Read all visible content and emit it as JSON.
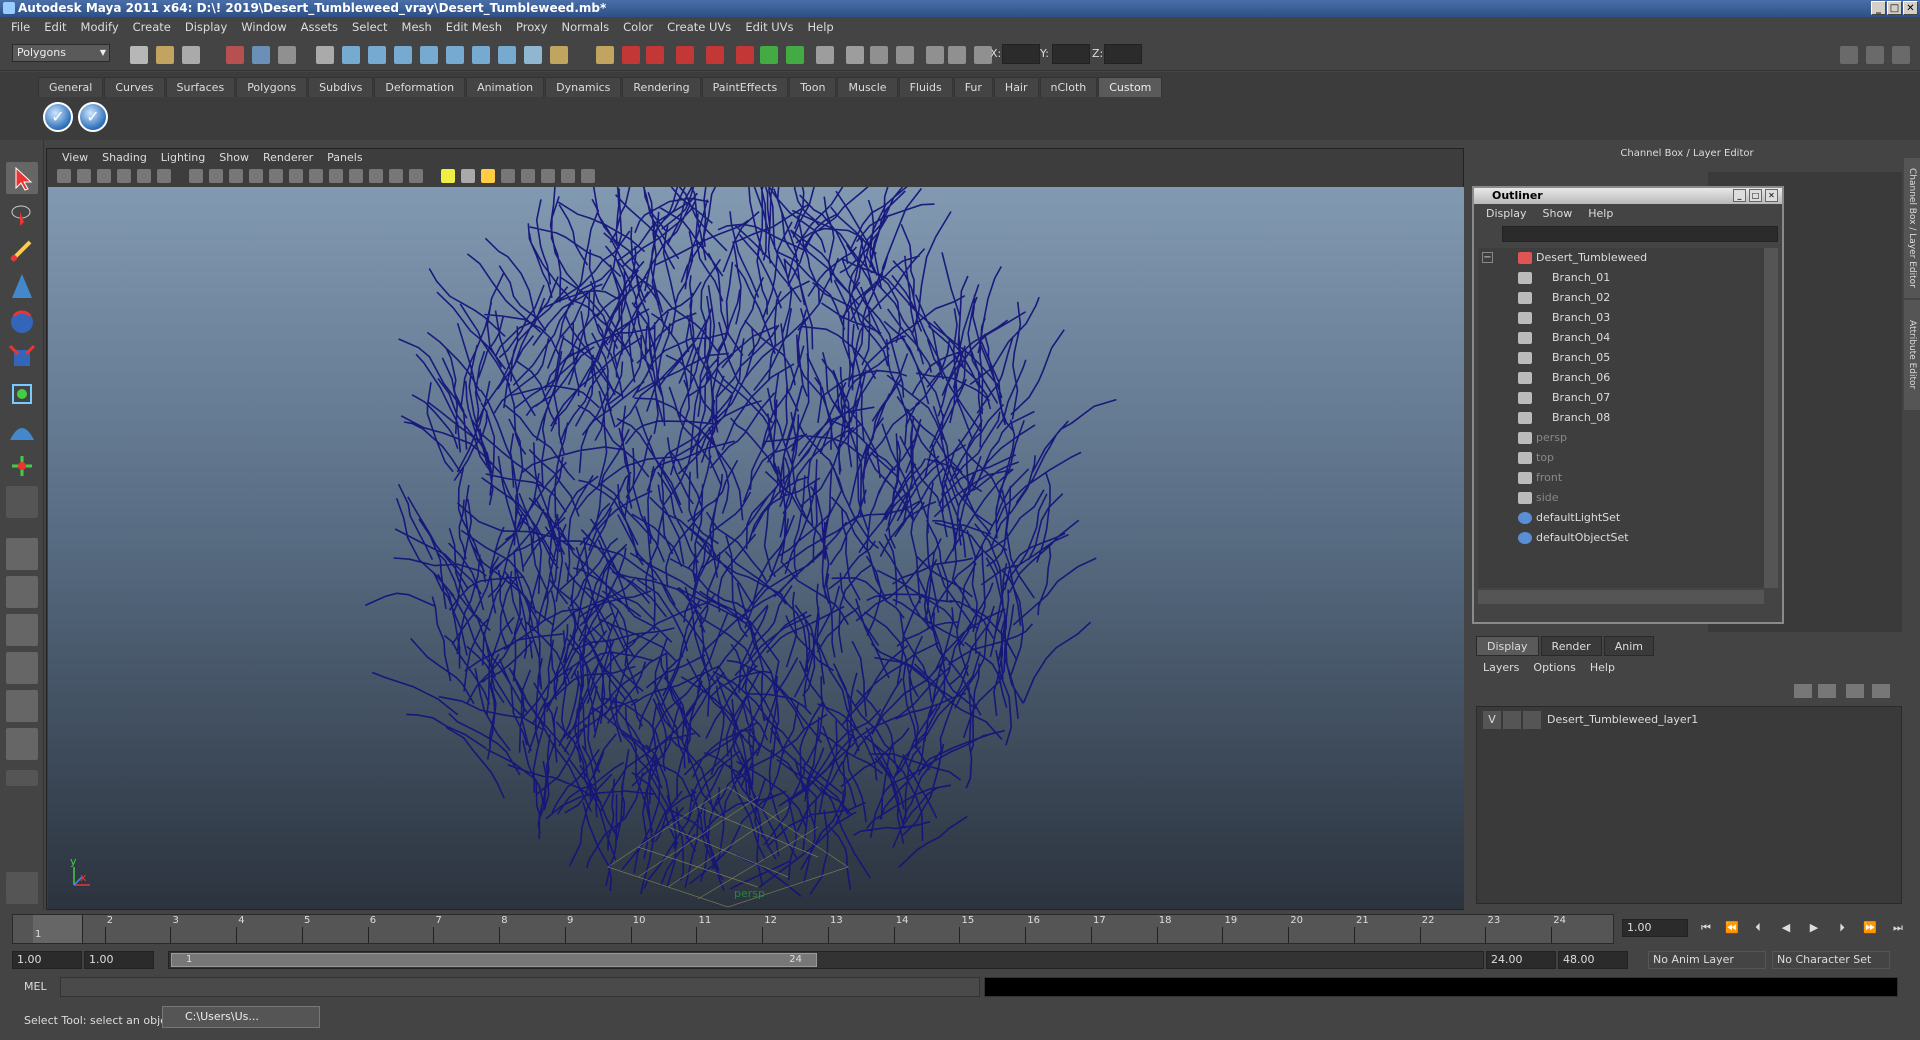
{
  "titlebar": {
    "title": "Autodesk Maya 2011 x64: D:\\! 2019\\Desert_Tumbleweed_vray\\Desert_Tumbleweed.mb*"
  },
  "menubar": [
    "File",
    "Edit",
    "Modify",
    "Create",
    "Display",
    "Window",
    "Assets",
    "Select",
    "Mesh",
    "Edit Mesh",
    "Proxy",
    "Normals",
    "Color",
    "Create UVs",
    "Edit UVs",
    "Help"
  ],
  "statusline": {
    "mode": "Polygons",
    "x_label": "X:",
    "y_label": "Y:",
    "z_label": "Z:"
  },
  "shelf": {
    "tabs": [
      "General",
      "Curves",
      "Surfaces",
      "Polygons",
      "Subdivs",
      "Deformation",
      "Animation",
      "Dynamics",
      "Rendering",
      "PaintEffects",
      "Toon",
      "Muscle",
      "Fluids",
      "Fur",
      "Hair",
      "nCloth",
      "Custom"
    ],
    "active": "Custom"
  },
  "viewport": {
    "menu": [
      "View",
      "Shading",
      "Lighting",
      "Show",
      "Renderer",
      "Panels"
    ],
    "camera_label": "persp",
    "axis_y": "y",
    "axis_x": "x"
  },
  "rightpanel": {
    "title": "Channel Box / Layer Editor",
    "vtab1": "Channel Box / Layer Editor",
    "vtab2": "Attribute Editor"
  },
  "outliner": {
    "title": "Outliner",
    "menu": [
      "Display",
      "Show",
      "Help"
    ],
    "items": [
      {
        "label": "Desert_Tumbleweed",
        "indent": 0,
        "dim": false
      },
      {
        "label": "Branch_01",
        "indent": 1,
        "dim": false
      },
      {
        "label": "Branch_02",
        "indent": 1,
        "dim": false
      },
      {
        "label": "Branch_03",
        "indent": 1,
        "dim": false
      },
      {
        "label": "Branch_04",
        "indent": 1,
        "dim": false
      },
      {
        "label": "Branch_05",
        "indent": 1,
        "dim": false
      },
      {
        "label": "Branch_06",
        "indent": 1,
        "dim": false
      },
      {
        "label": "Branch_07",
        "indent": 1,
        "dim": false
      },
      {
        "label": "Branch_08",
        "indent": 1,
        "dim": false
      },
      {
        "label": "persp",
        "indent": 0,
        "dim": true
      },
      {
        "label": "top",
        "indent": 0,
        "dim": true
      },
      {
        "label": "front",
        "indent": 0,
        "dim": true
      },
      {
        "label": "side",
        "indent": 0,
        "dim": true
      },
      {
        "label": "defaultLightSet",
        "indent": 0,
        "dim": false
      },
      {
        "label": "defaultObjectSet",
        "indent": 0,
        "dim": false
      }
    ]
  },
  "layers": {
    "tabs": [
      "Display",
      "Render",
      "Anim"
    ],
    "active": "Display",
    "menu": [
      "Layers",
      "Options",
      "Help"
    ],
    "row": {
      "v": "V",
      "name": "Desert_Tumbleweed_layer1"
    }
  },
  "timeline": {
    "ticks": [
      "1",
      "2",
      "3",
      "4",
      "5",
      "6",
      "7",
      "8",
      "9",
      "10",
      "11",
      "12",
      "13",
      "14",
      "15",
      "16",
      "17",
      "18",
      "19",
      "20",
      "21",
      "22",
      "23",
      "24"
    ],
    "current_marker": "1",
    "current_frame": "1.00"
  },
  "range": {
    "start_a": "1.00",
    "start_b": "1.00",
    "knob_start": "1",
    "knob_end": "24",
    "end_a": "24.00",
    "end_b": "48.00",
    "anim_layer": "No Anim Layer",
    "char_set": "No Character Set"
  },
  "mel": {
    "label": "MEL"
  },
  "help": {
    "text": "Select Tool: select an object",
    "taskbar": "C:\\Users\\Us..."
  }
}
